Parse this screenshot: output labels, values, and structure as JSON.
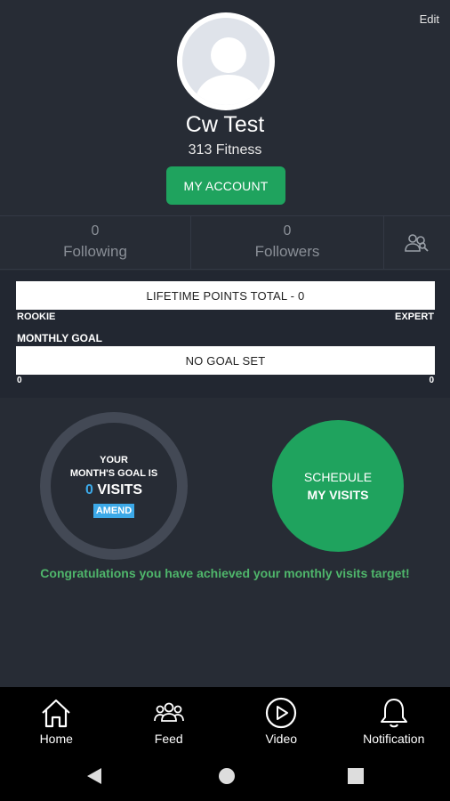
{
  "header": {
    "edit_label": "Edit",
    "name": "Cw Test",
    "gym": "313 Fitness",
    "account_button": "MY ACCOUNT"
  },
  "stats": {
    "following_count": "0",
    "following_label": "Following",
    "followers_count": "0",
    "followers_label": "Followers"
  },
  "points": {
    "lifetime_label": "LIFETIME POINTS TOTAL - 0",
    "rookie": "ROOKIE",
    "expert": "EXPERT",
    "monthly_goal_label": "MONTHLY GOAL",
    "goal_bar_label": "NO GOAL SET",
    "goal_min": "0",
    "goal_max": "0"
  },
  "goal_ring": {
    "line1": "YOUR",
    "line2": "MONTH'S GOAL IS",
    "visits_value": "0",
    "visits_unit": " VISITS",
    "amend_label": "AMEND"
  },
  "schedule": {
    "line1": "SCHEDULE",
    "line2": "MY VISITS"
  },
  "congrats_text": "Congratulations you have achieved your monthly visits target!",
  "bottom_nav": [
    {
      "label": "Home",
      "icon": "home-icon"
    },
    {
      "label": "Feed",
      "icon": "group-icon"
    },
    {
      "label": "Video",
      "icon": "play-icon"
    },
    {
      "label": "Notification",
      "icon": "bell-icon"
    }
  ],
  "colors": {
    "background": "#272c35",
    "accent_green": "#1fa35e",
    "accent_blue": "#3ca9e8",
    "congrats_green": "#4fb66b"
  }
}
